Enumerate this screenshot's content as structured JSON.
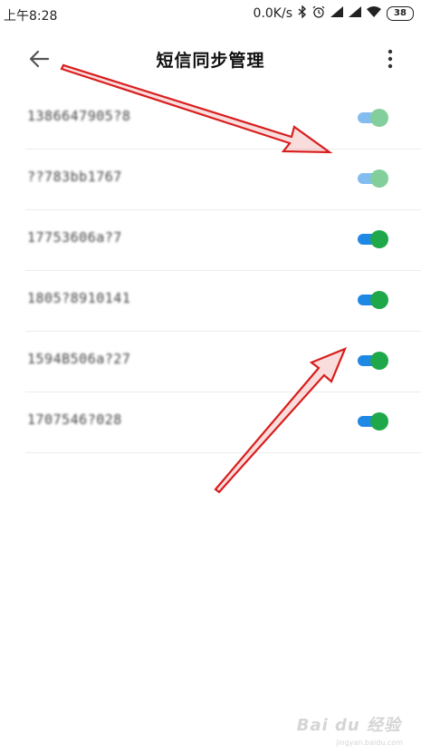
{
  "status_bar": {
    "time": "上午8:28",
    "network_speed": "0.0K/s",
    "battery": "38",
    "icons": [
      "bluetooth-icon",
      "alarm-icon",
      "signal-icon",
      "signal-icon",
      "wifi-icon",
      "battery-icon"
    ]
  },
  "header": {
    "title": "短信同步管理",
    "back_icon": "back-arrow-icon",
    "more_icon": "more-vertical-icon"
  },
  "colors": {
    "toggle_track_on": "#1e88e5",
    "toggle_knob_on": "#1fa84a",
    "annotation_arrow": "#d81e1e",
    "divider": "#ececec"
  },
  "list": {
    "items": [
      {
        "number": "1386647905?8",
        "toggle": "on",
        "dimmed": true
      },
      {
        "number": "??783bb1767",
        "toggle": "on",
        "dimmed": true
      },
      {
        "number": "17753606a?7",
        "toggle": "on",
        "dimmed": false
      },
      {
        "number": "1805?8910141",
        "toggle": "on",
        "dimmed": false
      },
      {
        "number": "1594B506a?27",
        "toggle": "on",
        "dimmed": false
      },
      {
        "number": "1707546?028",
        "toggle": "on",
        "dimmed": false
      }
    ]
  },
  "watermark": {
    "text": "Bai du 经验",
    "sub": "jingyan.baidu.com"
  }
}
